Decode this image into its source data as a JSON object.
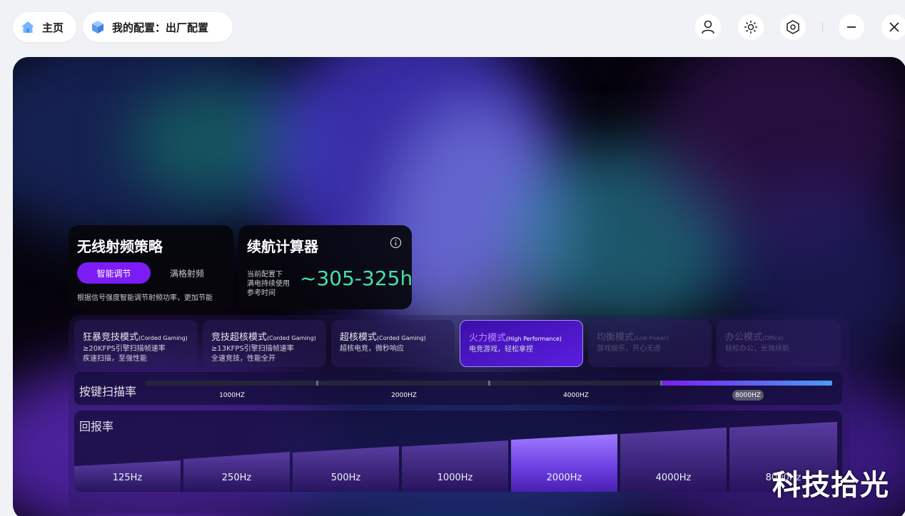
{
  "header": {
    "home_label": "主页",
    "config_label": "我的配置：出厂配置",
    "icons": [
      "home-icon",
      "cube-icon",
      "user-icon",
      "brightness-icon",
      "settings-hex-icon",
      "minimize-icon",
      "close-icon"
    ]
  },
  "rf_strategy": {
    "title": "无线射频策略",
    "smart_label": "智能调节",
    "full_label": "满格射频",
    "description": "根据信号强度智能调节射频功率，更加节能"
  },
  "battery_calc": {
    "title": "续航计算器",
    "line1": "当前配置下",
    "line2": "满电持续使用",
    "line3": "参考时间",
    "value": "~305-325h"
  },
  "modes": [
    {
      "name": "狂暴竞技模式",
      "sub": "(Corded Gaming)",
      "line1": "≥20KFPS引擎扫描帧速率",
      "line2": "疾速扫描，至强性能"
    },
    {
      "name": "竞技超核模式",
      "sub": "(Corded Gaming)",
      "line1": "≥13KFPS引擎扫描帧速率",
      "line2": "全速竞技，性能全开"
    },
    {
      "name": "超核模式",
      "sub": "(Corded Gaming)",
      "line1": "超核电竞，微秒响应",
      "line2": ""
    },
    {
      "name": "火力模式",
      "sub": "(High Performance)",
      "line1": "电竞游戏，轻松拿捏",
      "line2": ""
    },
    {
      "name": "均衡模式",
      "sub": "(Low Power)",
      "line1": "游戏娱乐，开心无虑",
      "line2": ""
    },
    {
      "name": "办公模式",
      "sub": "(Office)",
      "line1": "轻松办公，长效续航",
      "line2": ""
    }
  ],
  "active_mode_index": 3,
  "scan_rate": {
    "title": "按键扫描率",
    "options": [
      "1000HZ",
      "2000HZ",
      "4000HZ",
      "8000HZ"
    ],
    "selected": "8000HZ"
  },
  "report_rate": {
    "title": "回报率",
    "options": [
      "125Hz",
      "250Hz",
      "500Hz",
      "1000Hz",
      "2000Hz",
      "4000Hz",
      "8000Hz"
    ],
    "selected": "2000Hz"
  },
  "watermark": "科技拾光",
  "colors": {
    "accent": "#7b1cf5",
    "battery_value": "#46e0a6"
  }
}
